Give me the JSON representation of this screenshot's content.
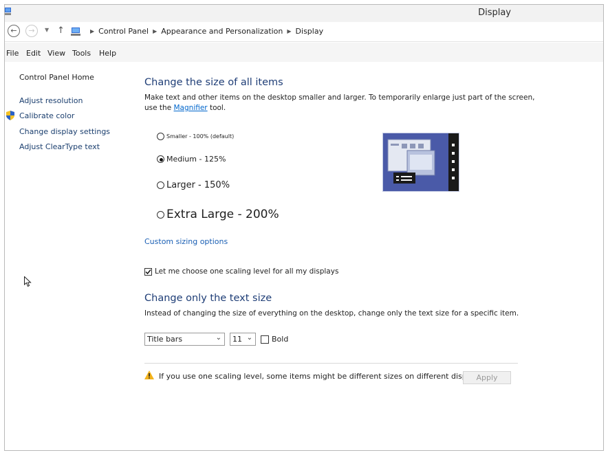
{
  "window": {
    "title": "Display"
  },
  "address": {
    "crumbs": [
      "Control Panel",
      "Appearance and Personalization",
      "Display"
    ]
  },
  "menu": [
    "File",
    "Edit",
    "View",
    "Tools",
    "Help"
  ],
  "sidebar": {
    "home": "Control Panel Home",
    "items": [
      "Adjust resolution",
      "Calibrate color",
      "Change display settings",
      "Adjust ClearType text"
    ]
  },
  "main": {
    "size_heading": "Change the size of all items",
    "size_desc_1": "Make text and other items on the desktop smaller and larger. To temporarily enlarge just part of the screen,",
    "size_desc_2_pre": "use the ",
    "size_desc_2_link": "Magnifier",
    "size_desc_2_post": " tool.",
    "options": [
      {
        "label": "Smaller - 100% (default)",
        "checked": false
      },
      {
        "label": "Medium - 125%",
        "checked": true
      },
      {
        "label": "Larger - 150%",
        "checked": false
      },
      {
        "label": "Extra Large - 200%",
        "checked": false
      }
    ],
    "custom_link": "Custom sizing options",
    "one_level_label": "Let me choose one scaling level for all my displays",
    "one_level_checked": true,
    "text_heading": "Change only the text size",
    "text_desc": "Instead of changing the size of everything on the desktop, change only the text size for a specific item.",
    "item_select": "Title bars",
    "size_select": "11",
    "bold_label": "Bold",
    "bold_checked": false,
    "warning": "If you use one scaling level, some items might be different sizes on different displays.",
    "apply": "Apply"
  },
  "colors": {
    "heading": "#1e3d76",
    "link": "#1a5fb4",
    "accent": "#3b4b9a"
  }
}
